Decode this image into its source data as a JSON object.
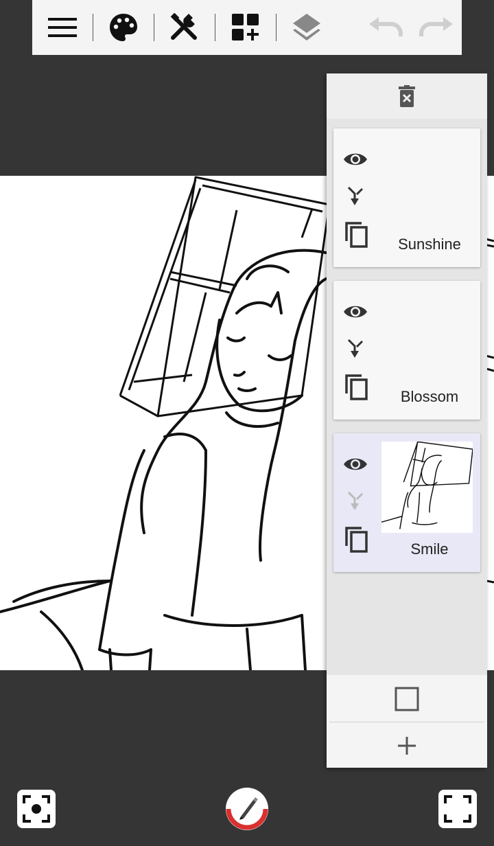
{
  "toolbar": {
    "items": [
      "menu-icon",
      "palette-icon",
      "tools-icon",
      "add-grid-icon",
      "layers-icon",
      "undo-icon",
      "redo-icon"
    ]
  },
  "layers_panel": {
    "top_action": "delete-layer-icon",
    "layers": [
      {
        "name": "Sunshine",
        "visible": true,
        "selected": false
      },
      {
        "name": "Blossom",
        "visible": true,
        "selected": false
      },
      {
        "name": "Smile",
        "visible": true,
        "selected": true
      }
    ],
    "bottom_actions": [
      "checkbox-icon",
      "add-icon"
    ]
  },
  "bottom_bar": {
    "left": "focus-icon",
    "center": "brush-tool-icon",
    "right": "fullscreen-icon"
  },
  "colors": {
    "background": "#353535",
    "toolbar": "#f4f4f4",
    "panel": "#e5e5e5",
    "selected_layer": "#e8e8f7",
    "brush_ring": "#d93030"
  }
}
